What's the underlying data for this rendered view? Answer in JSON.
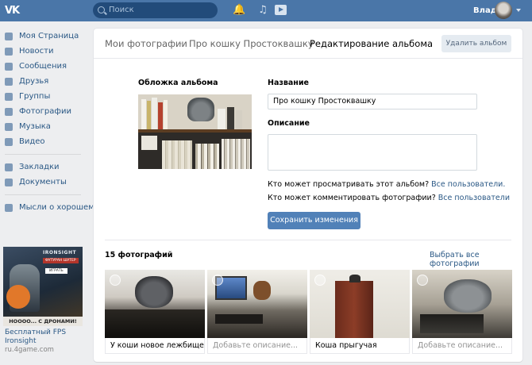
{
  "topbar": {
    "logo": "VK",
    "search_placeholder": "Поиск",
    "user_name": "Влад"
  },
  "sidebar": {
    "items": [
      {
        "label": "Моя Страница",
        "icon": "home-icon"
      },
      {
        "label": "Новости",
        "icon": "news-icon"
      },
      {
        "label": "Сообщения",
        "icon": "messages-icon"
      },
      {
        "label": "Друзья",
        "icon": "friends-icon"
      },
      {
        "label": "Группы",
        "icon": "groups-icon"
      },
      {
        "label": "Фотографии",
        "icon": "photos-icon"
      },
      {
        "label": "Музыка",
        "icon": "music-icon"
      },
      {
        "label": "Видео",
        "icon": "video-icon"
      }
    ],
    "items2": [
      {
        "label": "Закладки",
        "icon": "star-icon"
      },
      {
        "label": "Документы",
        "icon": "document-icon"
      }
    ],
    "items3": [
      {
        "label": "Мысли о хорошем...",
        "icon": "group-icon"
      }
    ],
    "ad": {
      "brand": "IRONSIGHT",
      "subtitle": "ФУТУРАН ШУТЕР",
      "button": "ИГРАТЬ",
      "tagline": "HOOOO... С ДРОНАМИ!",
      "title": "Бесплатный FPS Ironsight",
      "source": "ru.4game.com"
    }
  },
  "breadcrumb": {
    "items": [
      "Мои фотографии",
      "Про кошку Простоквашку",
      "Редактирование альбома"
    ],
    "separator": "›"
  },
  "header": {
    "delete_label": "Удалить альбом"
  },
  "form": {
    "cover_label": "Обложка альбома",
    "name_label": "Название",
    "name_value": "Про кошку Простоквашку",
    "desc_label": "Описание",
    "desc_value": "",
    "view_question": "Кто может просматривать этот альбом?",
    "view_value": "Все пользователи.",
    "comment_question": "Кто может комментировать фотографии?",
    "comment_value": "Все пользователи",
    "save_label": "Сохранить изменения"
  },
  "photos": {
    "count_label": "15 фотографий",
    "select_all_label": "Выбрать все фотографии",
    "items": [
      {
        "caption": "У коши новое лежбище",
        "placeholder": false
      },
      {
        "caption": "Добавьте описание...",
        "placeholder": true
      },
      {
        "caption": "Коша прыгучая",
        "placeholder": false
      },
      {
        "caption": "Добавьте описание...",
        "placeholder": true
      }
    ]
  }
}
